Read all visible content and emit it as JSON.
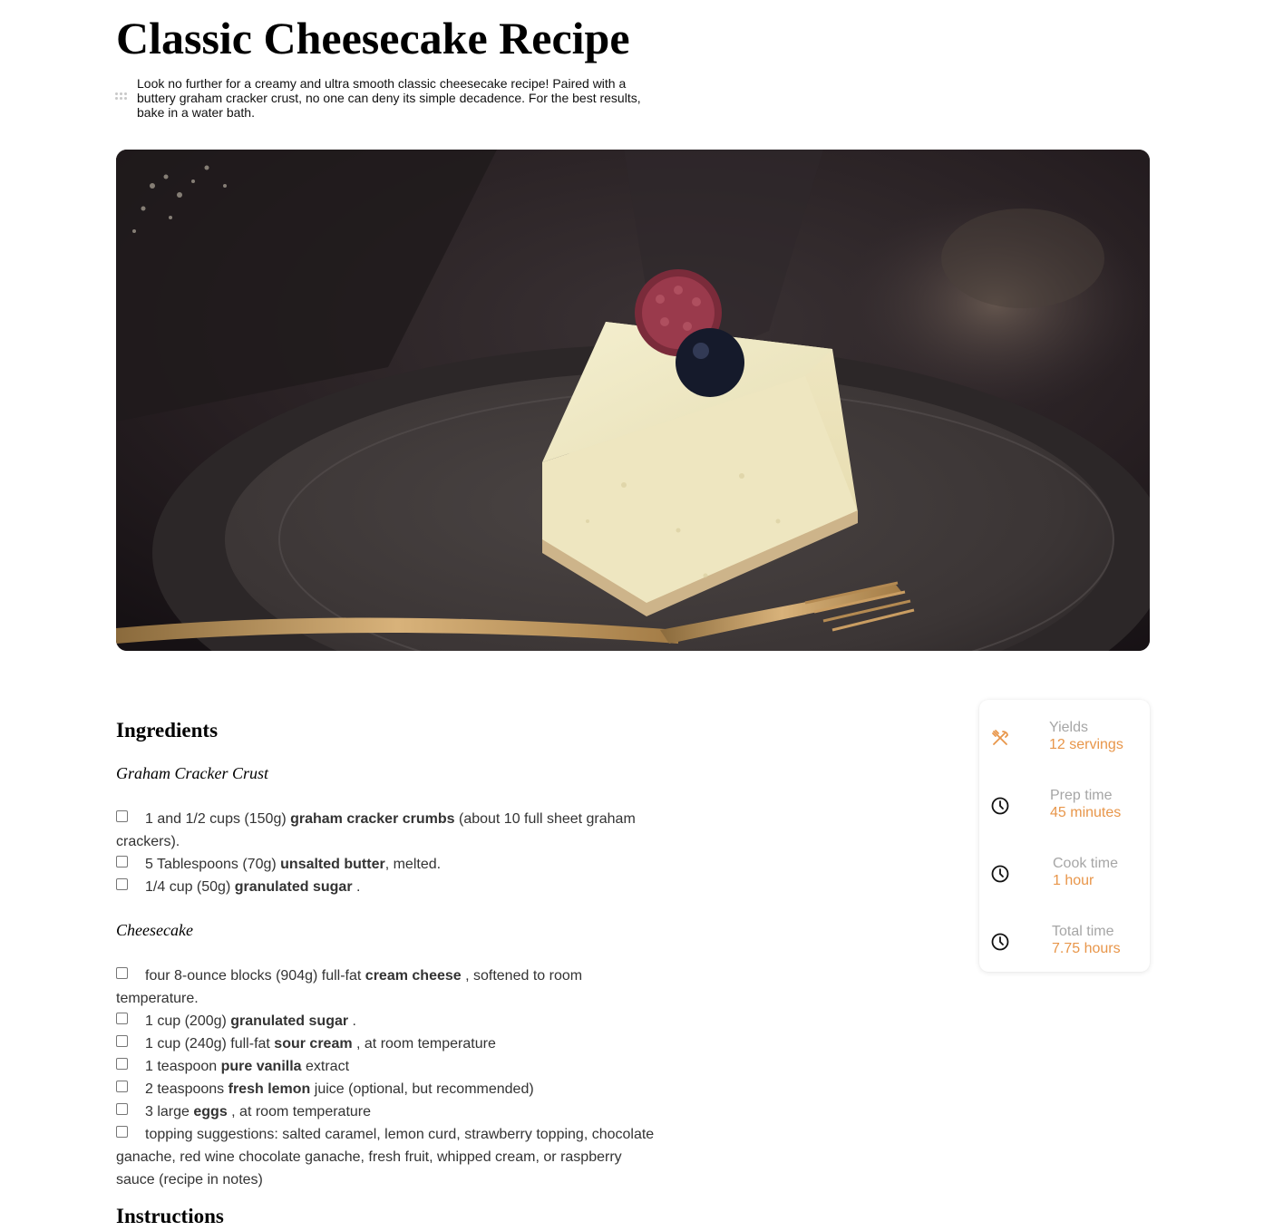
{
  "page": {
    "title": "Classic Cheesecake Recipe",
    "intro": "Look no further for a creamy and ultra smooth classic cheesecake recipe! Paired with a buttery graham cracker crust, no one can deny its simple decadence. For the best results, bake in a water bath."
  },
  "hero_image": {
    "alt": "Slice of cheesecake topped with a raspberry and blueberry on a dark plate with a gold fork"
  },
  "ingredients": {
    "heading": "Ingredients",
    "groups": [
      {
        "title": "Graham Cracker Crust",
        "items": [
          {
            "pre": "1 and 1/2 cups (150g) ",
            "bold": "graham cracker crumbs",
            "post": " (about 10 full sheet graham crackers)."
          },
          {
            "pre": "5 Tablespoons (70g) ",
            "bold": "unsalted butter",
            "post": ", melted."
          },
          {
            "pre": "1/4 cup (50g) ",
            "bold": "granulated sugar",
            "post": " ."
          }
        ]
      },
      {
        "title": "Cheesecake",
        "items": [
          {
            "pre": "four 8-ounce blocks (904g) full-fat ",
            "bold": "cream cheese",
            "post": " , softened to room temperature."
          },
          {
            "pre": "1 cup (200g) ",
            "bold": "granulated sugar",
            "post": " ."
          },
          {
            "pre": "1 cup (240g) full-fat ",
            "bold": "sour cream",
            "post": " , at room temperature"
          },
          {
            "pre": "1 teaspoon ",
            "bold": "pure vanilla",
            "post": " extract"
          },
          {
            "pre": "2 teaspoons ",
            "bold": "fresh lemon",
            "post": " juice (optional, but recommended)"
          },
          {
            "pre": "3 large ",
            "bold": "eggs",
            "post": " , at room temperature"
          },
          {
            "pre": "topping suggestions: salted caramel, lemon curd, strawberry topping, chocolate ganache, red wine chocolate ganache, fresh fruit, whipped cream, or raspberry sauce (recipe in notes)",
            "bold": "",
            "post": ""
          }
        ]
      }
    ]
  },
  "instructions": {
    "heading": "Instructions"
  },
  "info": {
    "accent_color": "#e8964a",
    "label_color": "#a6a6a6",
    "rows": [
      {
        "icon": "utensils-icon",
        "label": "Yields",
        "value": "12 servings"
      },
      {
        "icon": "clock-icon",
        "label": "Prep time",
        "value": "45 minutes"
      },
      {
        "icon": "clock-icon",
        "label": "Cook time",
        "value": "1 hour"
      },
      {
        "icon": "clock-icon",
        "label": "Total time",
        "value": "7.75 hours"
      }
    ]
  }
}
